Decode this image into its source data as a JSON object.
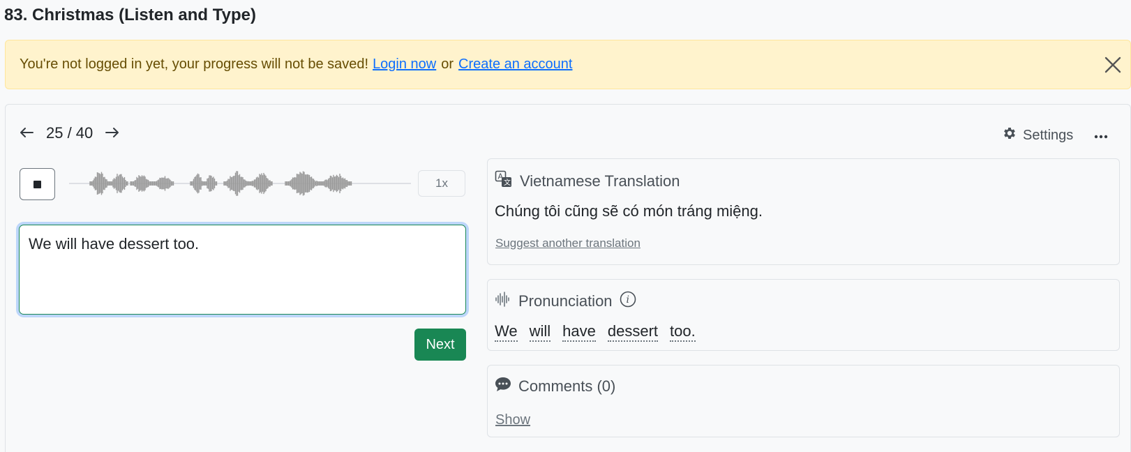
{
  "page": {
    "title": "83. Christmas (Listen and Type)"
  },
  "alert": {
    "message": "You're not logged in yet, your progress will not be saved!",
    "login_link": "Login now",
    "separator": "or",
    "create_link": "Create an account",
    "close_icon": "close-icon",
    "background": "#fff3cd",
    "text_color": "#664d03",
    "link_color": "#0d6efd"
  },
  "navigation": {
    "prev_icon": "arrow-left-icon",
    "position": "25 / 40",
    "next_icon": "arrow-right-icon"
  },
  "toolbar": {
    "settings_label": "Settings",
    "settings_icon": "gear-icon",
    "more_icon": "ellipsis-icon"
  },
  "player": {
    "stop_icon": "stop-icon",
    "speed_label": "1x"
  },
  "answer": {
    "value": "We will have dessert too."
  },
  "actions": {
    "next_label": "Next",
    "next_color": "#198754"
  },
  "translation": {
    "title": "Vietnamese Translation",
    "icon": "translate-icon",
    "text": "Chúng tôi cũng sẽ có món tráng miệng.",
    "suggest_link": "Suggest another translation"
  },
  "pronunciation": {
    "title": "Pronunciation",
    "icon": "soundwave-icon",
    "info_icon": "info-icon",
    "words": [
      "We",
      "will",
      "have",
      "dessert",
      "too."
    ]
  },
  "comments": {
    "title": "Comments (0)",
    "icon": "chat-icon",
    "show_link": "Show"
  }
}
